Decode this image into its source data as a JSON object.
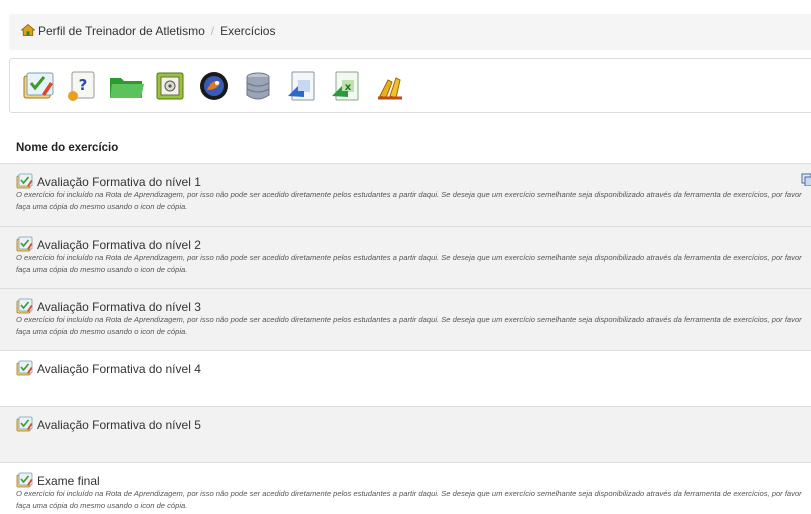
{
  "breadcrumb": {
    "items": [
      "Perfil de Treinador de Atletismo",
      "Exercícios"
    ]
  },
  "toolbar": {
    "tools": [
      {
        "icon": "new-test-icon"
      },
      {
        "icon": "question-pool-icon"
      },
      {
        "icon": "import-folder-icon"
      },
      {
        "icon": "safe-icon"
      },
      {
        "icon": "hotpotatoes-icon"
      },
      {
        "icon": "database-icon"
      },
      {
        "icon": "export-qti-icon"
      },
      {
        "icon": "export-excel-icon"
      },
      {
        "icon": "clean-results-icon"
      }
    ]
  },
  "table": {
    "column_header": "Nome do exercício",
    "rows": [
      {
        "title": "Avaliação Formativa do nível 1",
        "note": "O exercício foi incluído na Rota de Aprendizagem, por isso não pode ser acedido diretamente pelos estudantes a partir daqui. Se deseja que um exercício semelhante seja disponibilizado através da ferramenta de exercícios, por favor faça uma cópia do mesmo usando o icon de cópia.",
        "side_icon": "copy-icon"
      },
      {
        "title": "Avaliação Formativa do nível 2",
        "note": "O exercício foi incluído na Rota de Aprendizagem, por isso não pode ser acedido diretamente pelos estudantes a partir daqui. Se deseja que um exercício semelhante seja disponibilizado através da ferramenta de exercícios, por favor faça uma cópia do mesmo usando o icon de cópia."
      },
      {
        "title": "Avaliação Formativa do nível 3",
        "note": "O exercício foi incluído na Rota de Aprendizagem, por isso não pode ser acedido diretamente pelos estudantes a partir daqui. Se deseja que um exercício semelhante seja disponibilizado através da ferramenta de exercícios, por favor faça uma cópia do mesmo usando o icon de cópia."
      },
      {
        "title": "Avaliação Formativa do nível 4",
        "note": ""
      },
      {
        "title": "Avaliação Formativa do nível 5",
        "note": ""
      },
      {
        "title": "Exame final",
        "note": "O exercício foi incluído na Rota de Aprendizagem, por isso não pode ser acedido diretamente pelos estudantes a partir daqui. Se deseja que um exercício semelhante seja disponibilizado através da ferramenta de exercícios, por favor faça uma cópia do mesmo usando o icon de cópia."
      }
    ]
  }
}
